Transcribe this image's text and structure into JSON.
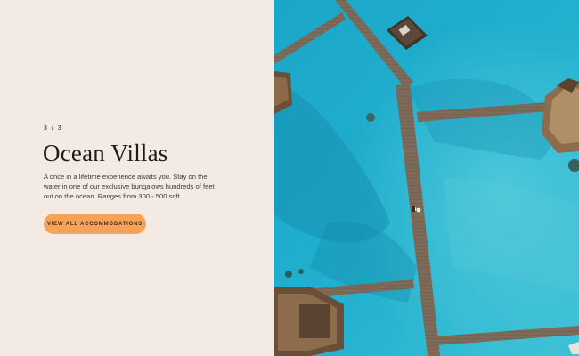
{
  "slide": {
    "counter": "3 / 3",
    "title": "Ocean Villas",
    "description": "A once in a lifetime experience awaits you. Stay on the water in one of our exclusive bungalows hundreds of feet out on the ocean. Ranges from 300 - 500 sqft.",
    "cta_label": "VIEW ALL ACCOMMODATIONS"
  },
  "colors": {
    "background": "#f3ebe3",
    "accent": "#f5a25a",
    "water": "#1fa8c9",
    "boardwalk": "#7a6654"
  },
  "image": {
    "subject": "aerial-overwater-villas-photo"
  }
}
